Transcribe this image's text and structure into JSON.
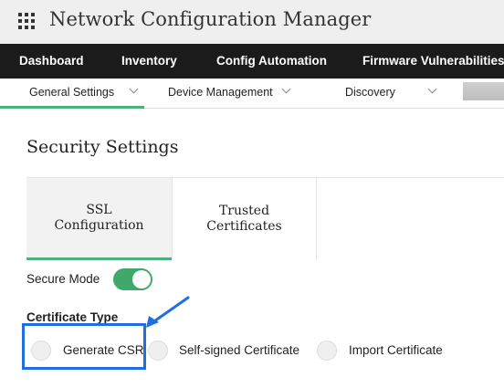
{
  "app": {
    "title": "Network Configuration Manager"
  },
  "main_nav": [
    "Dashboard",
    "Inventory",
    "Config Automation",
    "Firmware Vulnerabilities"
  ],
  "sub_nav": {
    "general_settings": "General Settings",
    "device_management": "Device Management",
    "discovery": "Discovery"
  },
  "page": {
    "title": "Security Settings"
  },
  "tabs": {
    "ssl_line1": "SSL",
    "ssl_line2": "Configuration",
    "trusted_line1": "Trusted",
    "trusted_line2": "Certificates"
  },
  "secure_mode": {
    "label": "Secure Mode",
    "enabled": true
  },
  "certificate_type": {
    "label": "Certificate Type",
    "options": [
      "Generate CSR",
      "Self-signed Certificate",
      "Import Certificate"
    ]
  },
  "colors": {
    "accent_green": "#3fa86a",
    "annotation_blue": "#1f6fe0",
    "nav_bg": "#1b1b1b"
  },
  "icons": {
    "app_menu": "grid-icon",
    "dropdown": "chevron-down-icon"
  }
}
